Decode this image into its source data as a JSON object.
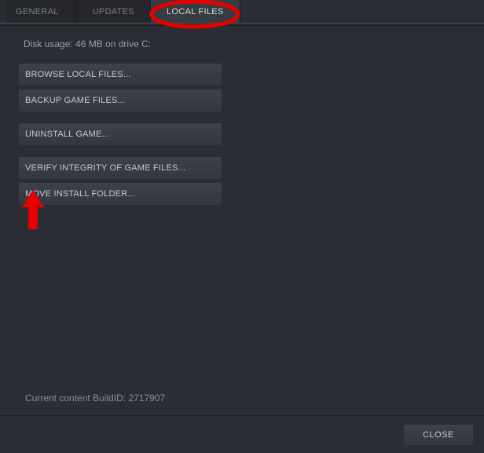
{
  "tabs": {
    "general": "GENERAL",
    "updates": "UPDATES",
    "local_files": "LOCAL FILES"
  },
  "disk_usage": "Disk usage: 46 MB on drive C:",
  "buttons": {
    "browse": "BROWSE LOCAL FILES...",
    "backup": "BACKUP GAME FILES...",
    "uninstall": "UNINSTALL GAME...",
    "verify": "VERIFY INTEGRITY OF GAME FILES...",
    "move": "MOVE INSTALL FOLDER..."
  },
  "build_id": "Current content BuildID: 2717907",
  "close": "CLOSE"
}
